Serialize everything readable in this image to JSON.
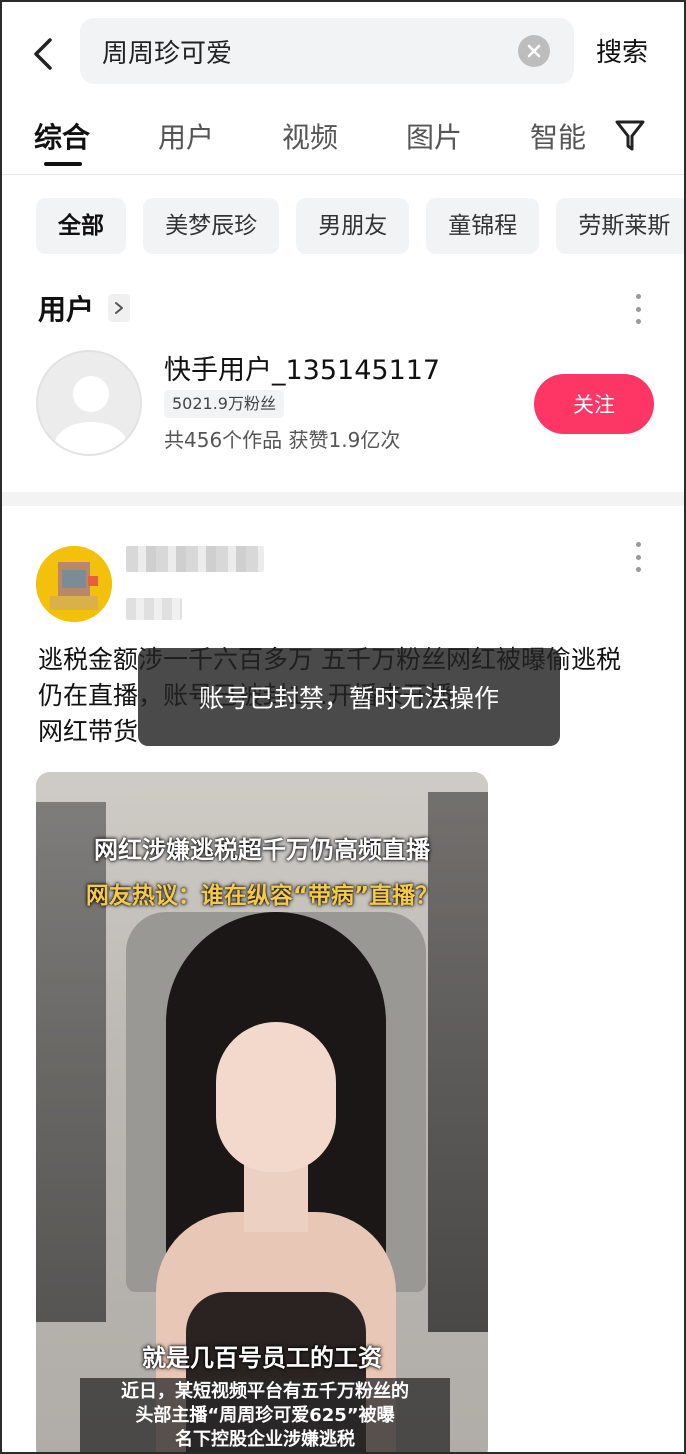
{
  "search": {
    "query": "周周珍可爱",
    "submit_label": "搜索"
  },
  "tabs": [
    {
      "label": "综合",
      "active": true
    },
    {
      "label": "用户",
      "active": false
    },
    {
      "label": "视频",
      "active": false
    },
    {
      "label": "图片",
      "active": false
    },
    {
      "label": "智能",
      "active": false
    }
  ],
  "chips": [
    {
      "label": "全部",
      "active": true
    },
    {
      "label": "美梦辰珍",
      "active": false
    },
    {
      "label": "男朋友",
      "active": false
    },
    {
      "label": "童锦程",
      "active": false
    },
    {
      "label": "劳斯莱斯",
      "active": false
    }
  ],
  "user_section": {
    "title": "用户",
    "user": {
      "name": "快手用户_135145117",
      "fans": "5021.9万粉丝",
      "stats": "共456个作品 获赞1.9亿次",
      "follow_label": "关注"
    }
  },
  "post": {
    "text_lines": [
      "逃税金额涉一千六百多万 五千万粉丝网红被曝偷逃税",
      "仍在直播，账号已被封1...开播未开播",
      "网红带货"
    ],
    "toast": "账号已封禁，暂时无法操作",
    "video": {
      "title_line1": "网红涉嫌逃税超千万仍高频直播",
      "title_line2": "网友热议：谁在纵容“带病”直播？",
      "subtitle_main": "就是几百号员工的工资",
      "caption_lines": [
        "近日，某短视频平台有五千万粉丝的",
        "头部主播“周周珍可爱625”被曝",
        "名下控股企业涉嫌逃税"
      ]
    }
  },
  "colors": {
    "accent": "#fe3666",
    "chip_bg": "#f2f3f5"
  }
}
